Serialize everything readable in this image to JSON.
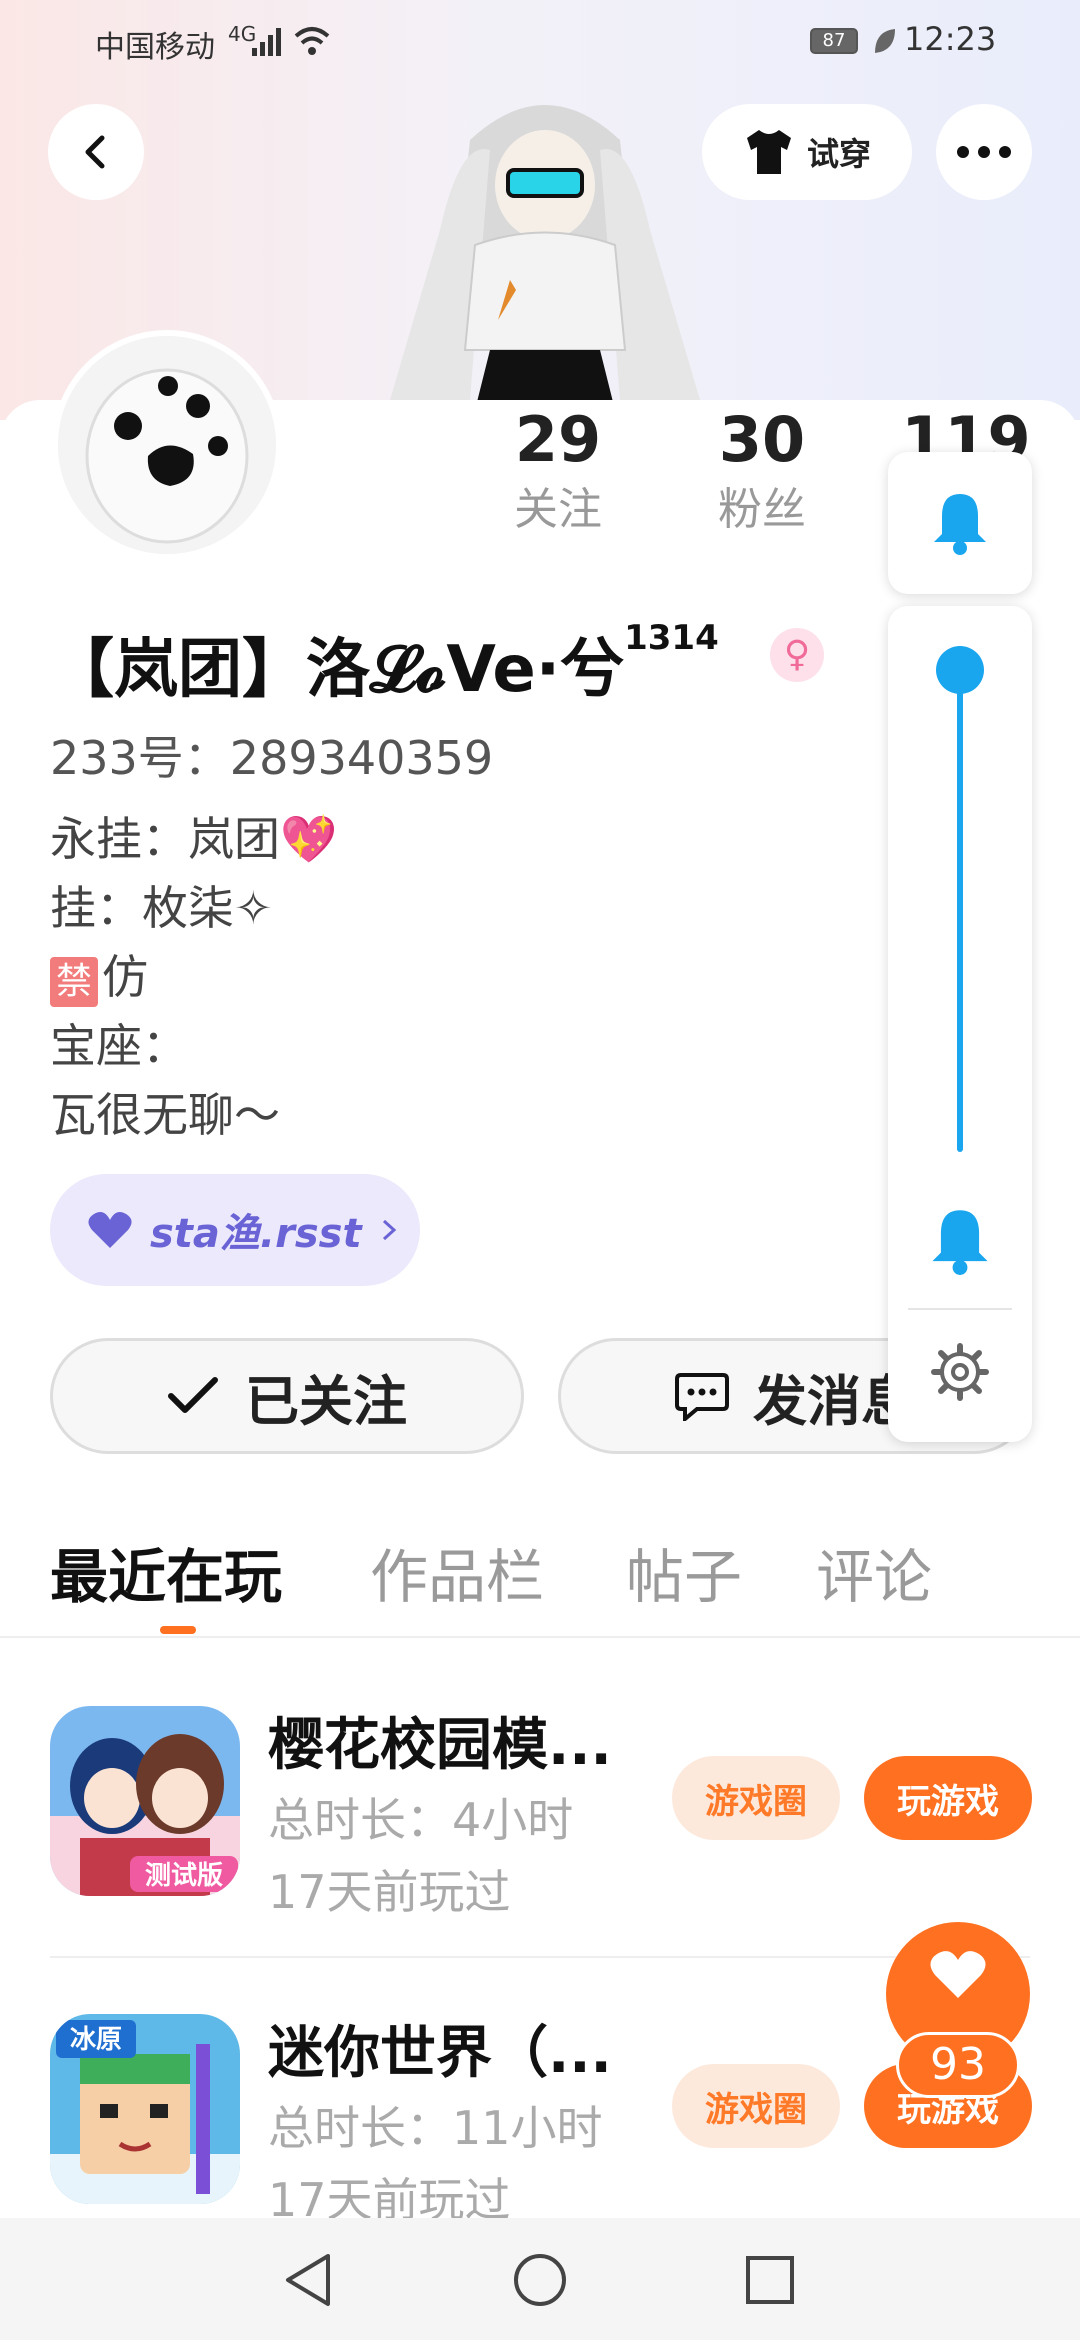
{
  "status_bar": {
    "carrier": "中国移动",
    "network": "4G",
    "battery": "87",
    "time": "12:23"
  },
  "header": {
    "tryon_label": "试穿"
  },
  "profile": {
    "stats": [
      {
        "num": "29",
        "label": "关注"
      },
      {
        "num": "30",
        "label": "粉丝"
      },
      {
        "num": "119",
        "label": ""
      }
    ],
    "nickname": "【岚团】洛𝓛𝓸Ve·兮",
    "nickname_sup": "1314",
    "gender_symbol": "♀",
    "uid": "233号：289340359",
    "bio_lines": [
      "永挂：岚团💖",
      "挂：枚柒✧",
      "仿",
      "宝座：",
      "瓦很无聊～"
    ],
    "ban_tag": "禁",
    "club_name": "sta渔.rsst"
  },
  "actions": {
    "follow_label": "已关注",
    "message_label": "发消息"
  },
  "tabs": [
    "最近在玩",
    "作品栏",
    "帖子",
    "评论"
  ],
  "games": [
    {
      "title": "樱花校园模...",
      "duration": "总时长：4小时",
      "last_played": "17天前玩过",
      "circle_label": "游戏圈",
      "play_label": "玩游戏",
      "badge": "测试版"
    },
    {
      "title": "迷你世界（...",
      "duration": "总时长：11小时",
      "last_played": "17天前玩过",
      "circle_label": "游戏圈",
      "play_label": "玩游戏",
      "badge": "冰原"
    }
  ],
  "like": {
    "count": "93"
  },
  "colors": {
    "accent": "#ff7020",
    "volume": "#1aa6ee"
  }
}
